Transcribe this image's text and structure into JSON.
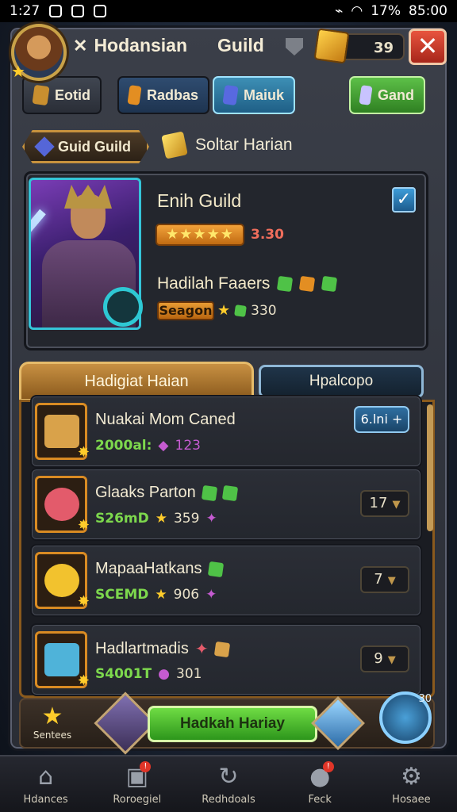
{
  "status_bar": {
    "time": "1:27",
    "battery": "17%",
    "clock_right": "85:00"
  },
  "header": {
    "title_prefix": "✕",
    "title": "Hodansian",
    "title_suffix": "Guild",
    "currency_value": "39"
  },
  "top_tabs": [
    {
      "label": "Eotid",
      "icon": "gold-cube-icon",
      "color": "#c98f2f"
    },
    {
      "label": "Radbas",
      "icon": "orange-cube-icon",
      "color": "#e38e22"
    },
    {
      "label": "Maiuk",
      "icon": "blue-cube-icon",
      "color": "#5869e0"
    },
    {
      "label": "Gand",
      "icon": "crystal-icon",
      "color": "#c8c3ff"
    }
  ],
  "section": {
    "guild_badge": "Guid Guild",
    "title": "Soltar Harian"
  },
  "hero": {
    "name": "Enih Guild",
    "stars": "★★★★★",
    "stars_value": "3.30",
    "reward_label": "Hadilah Faaers",
    "season_tag": "Seagon",
    "season_value": "330"
  },
  "lower_tabs": {
    "active": "Hadigiat Haian",
    "inactive": "Hpalcopo"
  },
  "items": [
    {
      "name": "Nuakai Mom Caned",
      "stat_green": "2000al:",
      "stat_tail": "123",
      "action": "6.lni +",
      "icon_color": "#d9a24a"
    },
    {
      "name": "Glaaks Parton",
      "stat_green": "S26mD",
      "stat_tail": "359",
      "qty": "17",
      "icon_color": "#e35b6b"
    },
    {
      "name": "MapaaHatkans",
      "stat_green": "SCEMD",
      "stat_tail": "906",
      "qty": "7",
      "icon_color": "#f2c22e"
    },
    {
      "name": "Hadlartmadis",
      "stat_green": "S4001T",
      "stat_tail": "301",
      "qty": "9",
      "icon_color": "#4fb3d9"
    }
  ],
  "action_bar": {
    "left_label": "Sentees",
    "main_button": "Hadkah Hariay",
    "badge_number": "30"
  },
  "nav": [
    {
      "label": "Hdances",
      "icon": "home-icon"
    },
    {
      "label": "Roroegiel",
      "icon": "cube-icon",
      "badge": "!"
    },
    {
      "label": "Redhdoals",
      "icon": "refresh-icon"
    },
    {
      "label": "Feck",
      "icon": "bomb-icon",
      "badge": "!"
    },
    {
      "label": "Hosaee",
      "icon": "gear-icon"
    }
  ]
}
